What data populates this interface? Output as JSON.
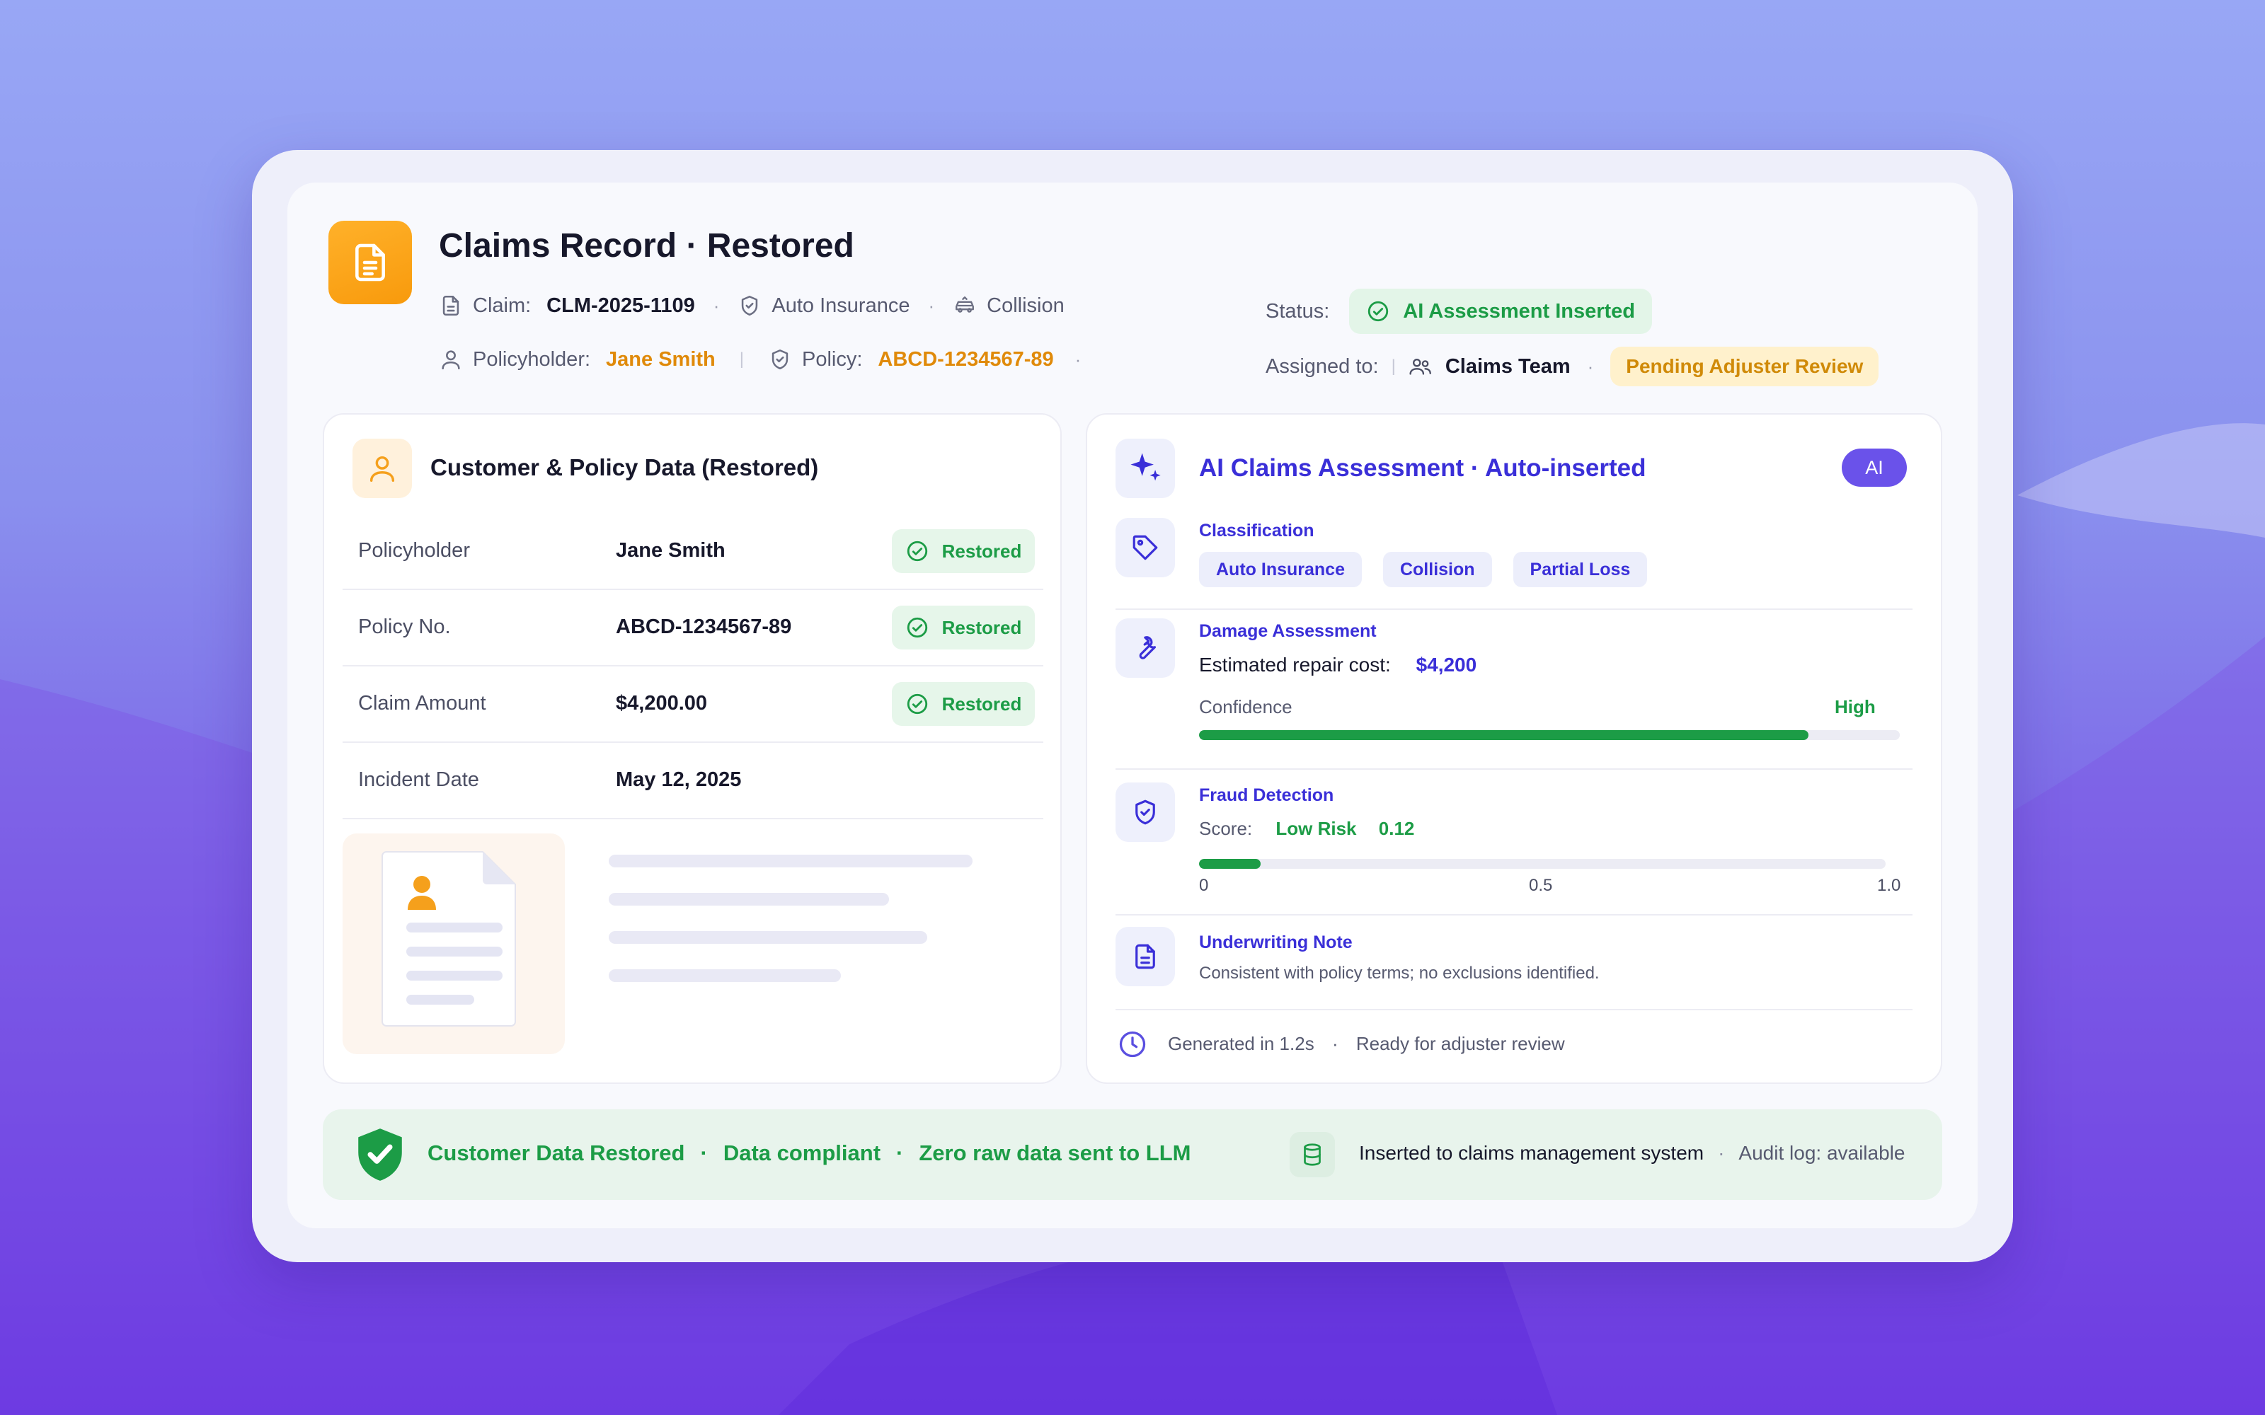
{
  "header": {
    "title": "Claims Record · Restored",
    "claim_label": "Claim:",
    "claim_id": "CLM-2025-1109",
    "line_of_business": "Auto Insurance",
    "incident_type": "Collision",
    "status_label": "Status:",
    "status_value": "AI Assessment Inserted",
    "policyholder_label": "Policyholder:",
    "policyholder_name": "Jane Smith",
    "policy_label": "Policy:",
    "policy_number": "ABCD-1234567-89",
    "assigned_label": "Assigned to:",
    "assigned_team": "Claims Team",
    "pending_badge": "Pending Adjuster Review"
  },
  "customer_card": {
    "title": "Customer & Policy Data (Restored)",
    "rows": [
      {
        "key": "Policyholder",
        "value": "Jane Smith",
        "badge": "Restored"
      },
      {
        "key": "Policy No.",
        "value": "ABCD-1234567-89",
        "badge": "Restored"
      },
      {
        "key": "Claim Amount",
        "value": "$4,200.00",
        "badge": "Restored"
      },
      {
        "key": "Incident Date",
        "value": "May 12, 2025",
        "badge": ""
      }
    ]
  },
  "ai_card": {
    "title": "AI Claims Assessment · Auto-inserted",
    "chip": "AI",
    "classification": {
      "title": "Classification",
      "tags": [
        "Auto Insurance",
        "Collision",
        "Partial Loss"
      ]
    },
    "damage": {
      "title": "Damage Assessment",
      "cost_label": "Estimated repair cost:",
      "cost_value": "$4,200",
      "confidence_label": "Confidence",
      "confidence_value": "High",
      "confidence_fraction": 0.87
    },
    "fraud": {
      "title": "Fraud Detection",
      "score_label": "Score:",
      "risk_label": "Low Risk",
      "score_value": "0.12",
      "score": 0.09,
      "ticks": [
        "0",
        "0.5",
        "1.0"
      ]
    },
    "underwriting": {
      "title": "Underwriting Note",
      "note": "Consistent with policy terms; no exclusions identified."
    },
    "footer": {
      "generated": "Generated in 1.2s",
      "ready": "Ready for adjuster review"
    }
  },
  "footer_strip": {
    "restored": "Customer Data Restored",
    "compliant": "Data compliant",
    "zero_raw": "Zero raw data sent to LLM",
    "inserted": "Inserted to claims management system",
    "audit": "Audit log: available"
  },
  "colors": {
    "accent_purple": "#3a2fd8",
    "success_green": "#1c9c46",
    "warning_orange": "#e08a0a",
    "badge_orange": "#f89a0c"
  }
}
